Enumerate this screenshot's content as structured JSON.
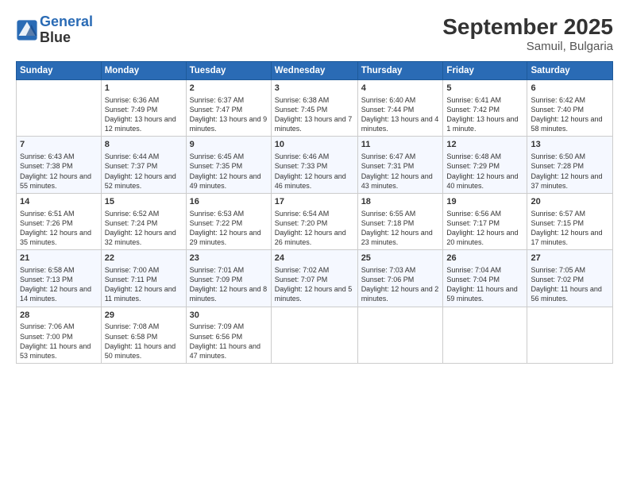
{
  "header": {
    "logo_line1": "General",
    "logo_line2": "Blue",
    "title": "September 2025",
    "subtitle": "Samuil, Bulgaria"
  },
  "columns": [
    "Sunday",
    "Monday",
    "Tuesday",
    "Wednesday",
    "Thursday",
    "Friday",
    "Saturday"
  ],
  "weeks": [
    [
      {
        "day": "",
        "sunrise": "",
        "sunset": "",
        "daylight": ""
      },
      {
        "day": "1",
        "sunrise": "Sunrise: 6:36 AM",
        "sunset": "Sunset: 7:49 PM",
        "daylight": "Daylight: 13 hours and 12 minutes."
      },
      {
        "day": "2",
        "sunrise": "Sunrise: 6:37 AM",
        "sunset": "Sunset: 7:47 PM",
        "daylight": "Daylight: 13 hours and 9 minutes."
      },
      {
        "day": "3",
        "sunrise": "Sunrise: 6:38 AM",
        "sunset": "Sunset: 7:45 PM",
        "daylight": "Daylight: 13 hours and 7 minutes."
      },
      {
        "day": "4",
        "sunrise": "Sunrise: 6:40 AM",
        "sunset": "Sunset: 7:44 PM",
        "daylight": "Daylight: 13 hours and 4 minutes."
      },
      {
        "day": "5",
        "sunrise": "Sunrise: 6:41 AM",
        "sunset": "Sunset: 7:42 PM",
        "daylight": "Daylight: 13 hours and 1 minute."
      },
      {
        "day": "6",
        "sunrise": "Sunrise: 6:42 AM",
        "sunset": "Sunset: 7:40 PM",
        "daylight": "Daylight: 12 hours and 58 minutes."
      }
    ],
    [
      {
        "day": "7",
        "sunrise": "Sunrise: 6:43 AM",
        "sunset": "Sunset: 7:38 PM",
        "daylight": "Daylight: 12 hours and 55 minutes."
      },
      {
        "day": "8",
        "sunrise": "Sunrise: 6:44 AM",
        "sunset": "Sunset: 7:37 PM",
        "daylight": "Daylight: 12 hours and 52 minutes."
      },
      {
        "day": "9",
        "sunrise": "Sunrise: 6:45 AM",
        "sunset": "Sunset: 7:35 PM",
        "daylight": "Daylight: 12 hours and 49 minutes."
      },
      {
        "day": "10",
        "sunrise": "Sunrise: 6:46 AM",
        "sunset": "Sunset: 7:33 PM",
        "daylight": "Daylight: 12 hours and 46 minutes."
      },
      {
        "day": "11",
        "sunrise": "Sunrise: 6:47 AM",
        "sunset": "Sunset: 7:31 PM",
        "daylight": "Daylight: 12 hours and 43 minutes."
      },
      {
        "day": "12",
        "sunrise": "Sunrise: 6:48 AM",
        "sunset": "Sunset: 7:29 PM",
        "daylight": "Daylight: 12 hours and 40 minutes."
      },
      {
        "day": "13",
        "sunrise": "Sunrise: 6:50 AM",
        "sunset": "Sunset: 7:28 PM",
        "daylight": "Daylight: 12 hours and 37 minutes."
      }
    ],
    [
      {
        "day": "14",
        "sunrise": "Sunrise: 6:51 AM",
        "sunset": "Sunset: 7:26 PM",
        "daylight": "Daylight: 12 hours and 35 minutes."
      },
      {
        "day": "15",
        "sunrise": "Sunrise: 6:52 AM",
        "sunset": "Sunset: 7:24 PM",
        "daylight": "Daylight: 12 hours and 32 minutes."
      },
      {
        "day": "16",
        "sunrise": "Sunrise: 6:53 AM",
        "sunset": "Sunset: 7:22 PM",
        "daylight": "Daylight: 12 hours and 29 minutes."
      },
      {
        "day": "17",
        "sunrise": "Sunrise: 6:54 AM",
        "sunset": "Sunset: 7:20 PM",
        "daylight": "Daylight: 12 hours and 26 minutes."
      },
      {
        "day": "18",
        "sunrise": "Sunrise: 6:55 AM",
        "sunset": "Sunset: 7:18 PM",
        "daylight": "Daylight: 12 hours and 23 minutes."
      },
      {
        "day": "19",
        "sunrise": "Sunrise: 6:56 AM",
        "sunset": "Sunset: 7:17 PM",
        "daylight": "Daylight: 12 hours and 20 minutes."
      },
      {
        "day": "20",
        "sunrise": "Sunrise: 6:57 AM",
        "sunset": "Sunset: 7:15 PM",
        "daylight": "Daylight: 12 hours and 17 minutes."
      }
    ],
    [
      {
        "day": "21",
        "sunrise": "Sunrise: 6:58 AM",
        "sunset": "Sunset: 7:13 PM",
        "daylight": "Daylight: 12 hours and 14 minutes."
      },
      {
        "day": "22",
        "sunrise": "Sunrise: 7:00 AM",
        "sunset": "Sunset: 7:11 PM",
        "daylight": "Daylight: 12 hours and 11 minutes."
      },
      {
        "day": "23",
        "sunrise": "Sunrise: 7:01 AM",
        "sunset": "Sunset: 7:09 PM",
        "daylight": "Daylight: 12 hours and 8 minutes."
      },
      {
        "day": "24",
        "sunrise": "Sunrise: 7:02 AM",
        "sunset": "Sunset: 7:07 PM",
        "daylight": "Daylight: 12 hours and 5 minutes."
      },
      {
        "day": "25",
        "sunrise": "Sunrise: 7:03 AM",
        "sunset": "Sunset: 7:06 PM",
        "daylight": "Daylight: 12 hours and 2 minutes."
      },
      {
        "day": "26",
        "sunrise": "Sunrise: 7:04 AM",
        "sunset": "Sunset: 7:04 PM",
        "daylight": "Daylight: 11 hours and 59 minutes."
      },
      {
        "day": "27",
        "sunrise": "Sunrise: 7:05 AM",
        "sunset": "Sunset: 7:02 PM",
        "daylight": "Daylight: 11 hours and 56 minutes."
      }
    ],
    [
      {
        "day": "28",
        "sunrise": "Sunrise: 7:06 AM",
        "sunset": "Sunset: 7:00 PM",
        "daylight": "Daylight: 11 hours and 53 minutes."
      },
      {
        "day": "29",
        "sunrise": "Sunrise: 7:08 AM",
        "sunset": "Sunset: 6:58 PM",
        "daylight": "Daylight: 11 hours and 50 minutes."
      },
      {
        "day": "30",
        "sunrise": "Sunrise: 7:09 AM",
        "sunset": "Sunset: 6:56 PM",
        "daylight": "Daylight: 11 hours and 47 minutes."
      },
      {
        "day": "",
        "sunrise": "",
        "sunset": "",
        "daylight": ""
      },
      {
        "day": "",
        "sunrise": "",
        "sunset": "",
        "daylight": ""
      },
      {
        "day": "",
        "sunrise": "",
        "sunset": "",
        "daylight": ""
      },
      {
        "day": "",
        "sunrise": "",
        "sunset": "",
        "daylight": ""
      }
    ]
  ]
}
